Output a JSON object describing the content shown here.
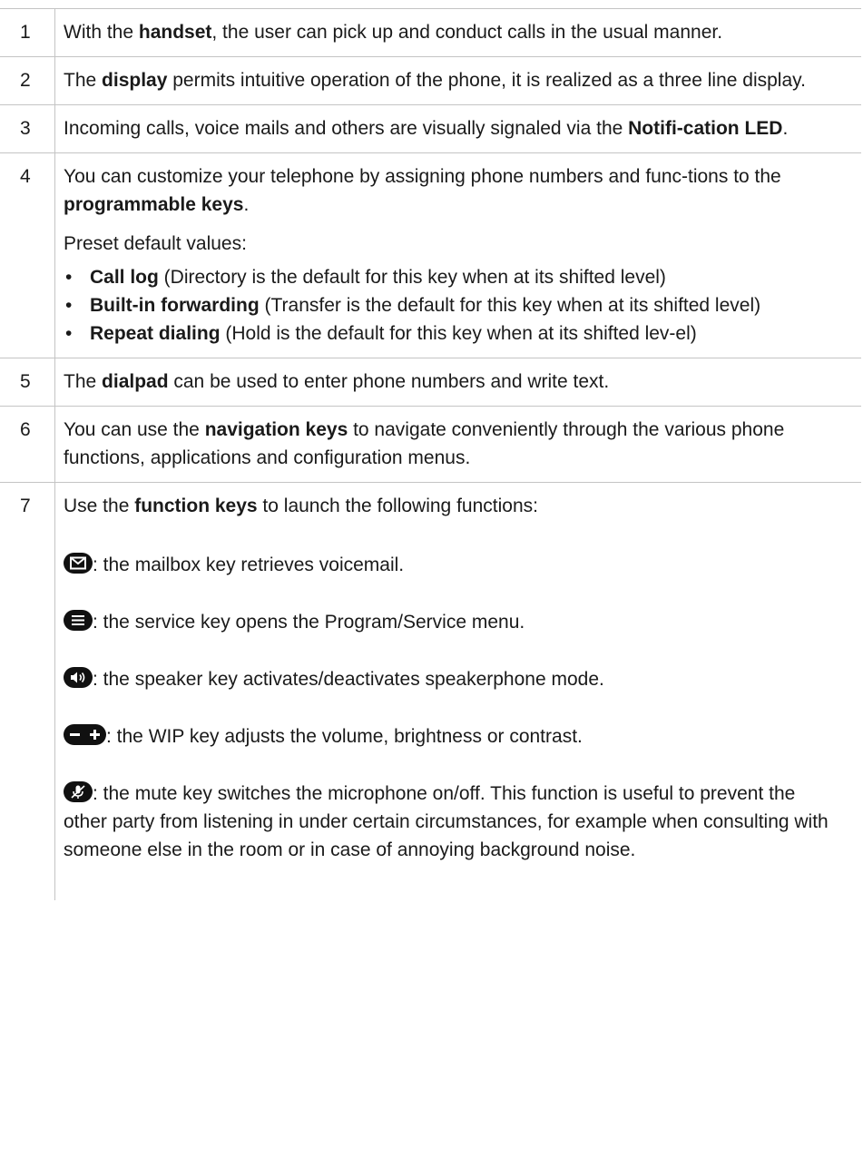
{
  "rows": [
    {
      "num": "1",
      "a": "With the ",
      "b": "handset",
      "c": ", the user can pick up and conduct calls in the usual manner."
    },
    {
      "num": "2",
      "a": "The ",
      "b": "display",
      "c": " permits intuitive operation of the phone, it is realized as a three line display."
    },
    {
      "num": "3",
      "a": "Incoming calls, voice mails and others are visually signaled via the ",
      "b": "Notifi-cation LED",
      "c": "."
    },
    {
      "num": "4",
      "a": "You can customize your telephone by assigning phone numbers and func-tions to the ",
      "b": "programmable keys",
      "c": ".",
      "preset": "Preset default values:",
      "bullets": [
        {
          "b": "Call log",
          "t": " (Directory is the default for this key when at its shifted level)"
        },
        {
          "b": "Built-in forwarding",
          "t": " (Transfer is the default for this key when at its shifted level)"
        },
        {
          "b": "Repeat dialing",
          "t": " (Hold is the default for this key when at its shifted lev-el)"
        }
      ]
    },
    {
      "num": "5",
      "a": "The ",
      "b": "dialpad",
      "c": " can be used to enter phone numbers and write text."
    },
    {
      "num": "6",
      "a": "You can use the ",
      "b": "navigation keys",
      "c": " to navigate conveniently through the various phone functions, applications and configuration menus."
    },
    {
      "num": "7",
      "a": "Use the ",
      "b": "function keys",
      "c": " to launch the following functions:",
      "keys": [
        {
          "icon": "mailbox-icon",
          "text": ": the mailbox key retrieves voicemail."
        },
        {
          "icon": "service-icon",
          "text": ": the service key opens the Program/Service menu."
        },
        {
          "icon": "speaker-icon",
          "text": ": the speaker key activates/deactivates speakerphone mode."
        },
        {
          "icon": "volume-minus-plus-icon",
          "text": ": the WIP key adjusts the volume, brightness or contrast."
        },
        {
          "icon": "mute-icon",
          "text": ": the mute key switches the microphone on/off. This function is useful to prevent the other party from listening in under certain circumstances, for example when consulting with someone else in the room or in case of annoying background noise."
        }
      ]
    }
  ]
}
